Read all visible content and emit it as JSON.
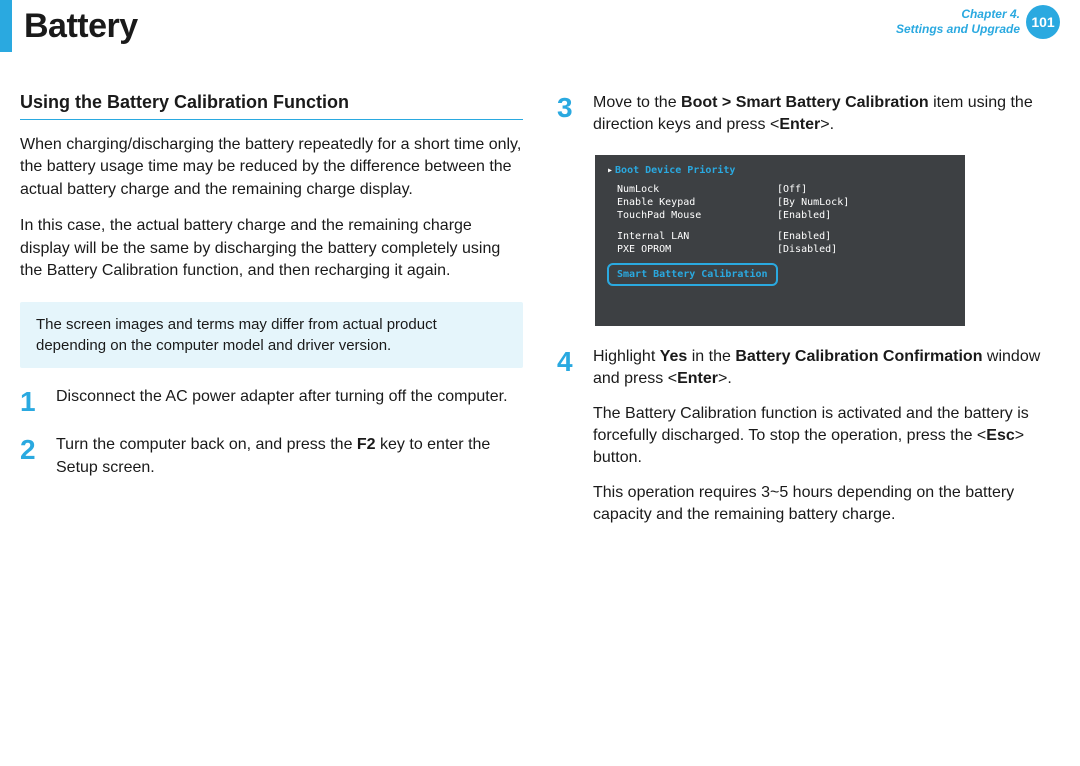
{
  "header": {
    "title": "Battery",
    "chapter_line1": "Chapter 4.",
    "chapter_line2": "Settings and Upgrade",
    "page_number": "101"
  },
  "left": {
    "section_heading": "Using the Battery Calibration Function",
    "para1": "When charging/discharging the battery repeatedly for a short time only, the battery usage time may be reduced by the difference between the actual battery charge and the remaining charge display.",
    "para2": "In this case, the actual battery charge and the remaining charge display will be the same by discharging the battery completely using the Battery Calibration function, and then recharging it again.",
    "note": "The screen images and terms may differ from actual product depending on the computer model and driver version.",
    "step1_num": "1",
    "step1_text": "Disconnect the AC power adapter after turning off the computer.",
    "step2_num": "2",
    "step2_text_a": "Turn the computer back on, and press the ",
    "step2_key": "F2",
    "step2_text_b": " key to enter the Setup screen."
  },
  "right": {
    "step3_num": "3",
    "step3_text_a": "Move to the ",
    "step3_bold1": "Boot > Smart Battery Calibration",
    "step3_text_b": " item using the direction keys and press <",
    "step3_bold2": "Enter",
    "step3_text_c": ">.",
    "step4_num": "4",
    "step4_text_a": "Highlight ",
    "step4_bold1": "Yes",
    "step4_text_b": " in the ",
    "step4_bold2": "Battery Calibration Confirmation",
    "step4_text_c": " window and press <",
    "step4_bold3": "Enter",
    "step4_text_d": ">.",
    "step4_p2_a": "The Battery Calibration function is activated and the battery is forcefully discharged. To stop the operation, press the <",
    "step4_p2_bold": "Esc",
    "step4_p2_b": "> button.",
    "step4_p3": "This operation requires 3~5 hours depending on the battery capacity and the remaining battery charge."
  },
  "bios": {
    "header": "Boot Device Priority",
    "rows": [
      {
        "k": "NumLock",
        "v": "[Off]"
      },
      {
        "k": "Enable Keypad",
        "v": "[By NumLock]"
      },
      {
        "k": "TouchPad Mouse",
        "v": "[Enabled]"
      }
    ],
    "rows2": [
      {
        "k": "Internal LAN",
        "v": "[Enabled]"
      },
      {
        "k": "PXE OPROM",
        "v": "[Disabled]"
      }
    ],
    "highlight": "Smart Battery Calibration"
  }
}
